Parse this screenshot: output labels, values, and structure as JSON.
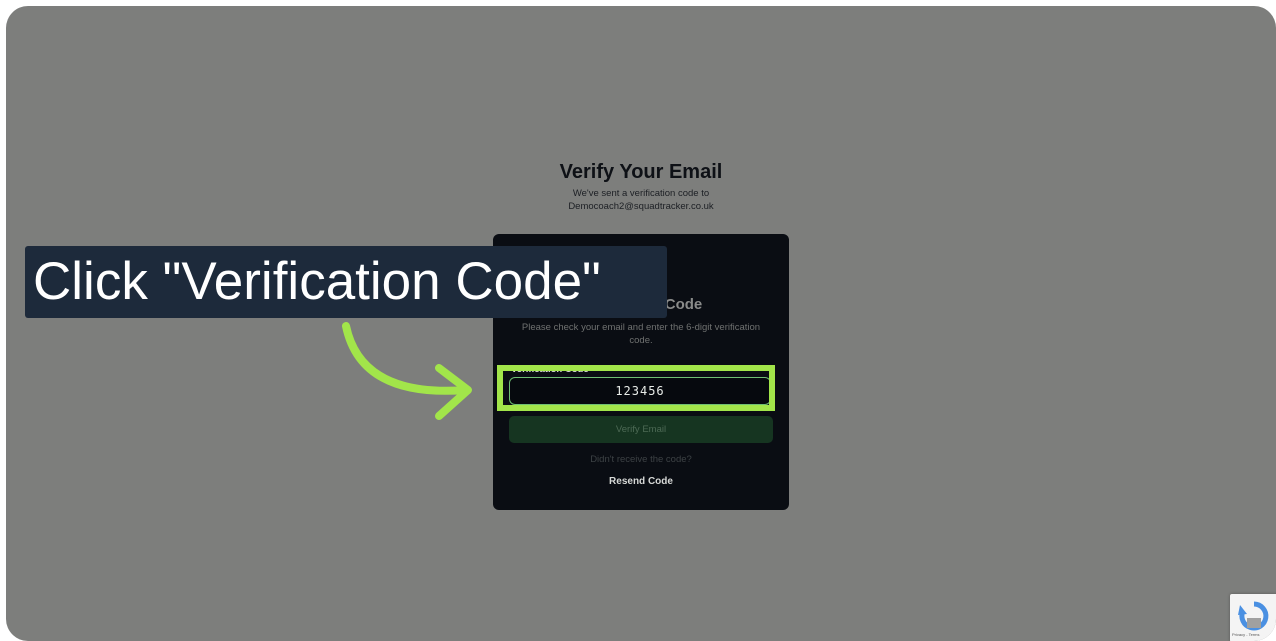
{
  "page": {
    "heading": "Verify Your Email",
    "subtext_line1": "We've sent a verification code to",
    "subtext_line2": "Democoach2@squadtracker.co.uk"
  },
  "card": {
    "title": "Verification Code",
    "description": "Please check your email and enter the 6-digit verification code.",
    "field_label": "Verification Code",
    "code_value": "123456",
    "verify_button": "Verify Email",
    "didnt_receive": "Didn't receive the code?",
    "resend_button": "Resend Code"
  },
  "overlay": {
    "tooltip_text": "Click \"Verification Code\"",
    "accent_color": "#a2e54a",
    "tooltip_bg": "#1d2a3b"
  },
  "recaptcha": {
    "label": "Privacy - Terms"
  },
  "colors": {
    "backdrop": "#7d7e7c",
    "card_bg": "#0a0d13",
    "verify_button_bg": "#163521"
  }
}
